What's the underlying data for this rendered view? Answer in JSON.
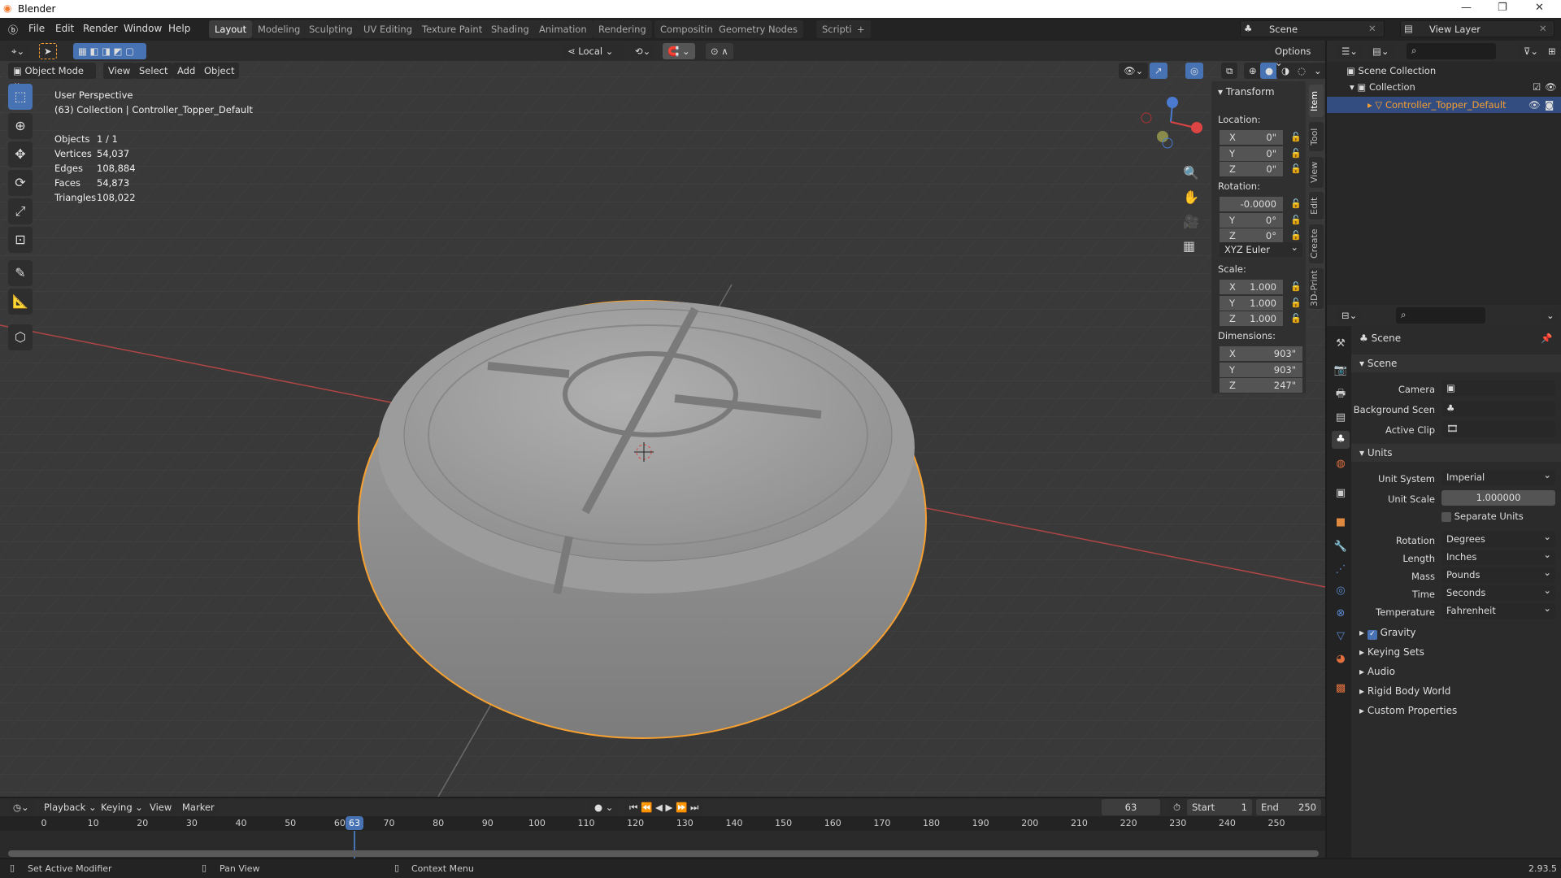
{
  "window": {
    "title": "Blender",
    "controls": [
      "—",
      "❐",
      "✕"
    ]
  },
  "menu": [
    "File",
    "Edit",
    "Render",
    "Window",
    "Help"
  ],
  "workspaces": [
    "Layout",
    "Modeling",
    "Sculpting",
    "UV Editing",
    "Texture Paint",
    "Shading",
    "Animation",
    "Rendering",
    "Compositing",
    "Geometry Nodes",
    "Scripting",
    "+"
  ],
  "active_workspace": "Layout",
  "scene": {
    "name": "Scene",
    "view_layer": "View Layer"
  },
  "viewport_header": {
    "transform_orientation": "Local",
    "options": "Options",
    "mode": "Object Mode",
    "menus": [
      "View",
      "Select",
      "Add",
      "Object"
    ]
  },
  "overlay": {
    "view": "User Perspective",
    "context": "(63) Collection | Controller_Topper_Default",
    "stats": [
      {
        "label": "Objects",
        "value": "1 / 1"
      },
      {
        "label": "Vertices",
        "value": "54,037"
      },
      {
        "label": "Edges",
        "value": "108,884"
      },
      {
        "label": "Faces",
        "value": "54,873"
      },
      {
        "label": "Triangles",
        "value": "108,022"
      }
    ]
  },
  "tools": [
    "select-box",
    "cursor",
    "move",
    "rotate",
    "scale",
    "transform",
    "annotate",
    "measure",
    "add-cube"
  ],
  "npanel": {
    "title": "Transform",
    "location_label": "Location:",
    "location": [
      {
        "axis": "X",
        "value": "0\""
      },
      {
        "axis": "Y",
        "value": "0\""
      },
      {
        "axis": "Z",
        "value": "0\""
      }
    ],
    "rotation_label": "Rotation:",
    "rotation": [
      {
        "axis": "",
        "value": "-0.0000"
      },
      {
        "axis": "Y",
        "value": "0°"
      },
      {
        "axis": "Z",
        "value": "0°"
      }
    ],
    "rotation_mode": "XYZ Euler",
    "scale_label": "Scale:",
    "scale": [
      {
        "axis": "X",
        "value": "1.000"
      },
      {
        "axis": "Y",
        "value": "1.000"
      },
      {
        "axis": "Z",
        "value": "1.000"
      }
    ],
    "dimensions_label": "Dimensions:",
    "dimensions": [
      {
        "axis": "X",
        "value": "903\""
      },
      {
        "axis": "Y",
        "value": "903\""
      },
      {
        "axis": "Z",
        "value": "247\""
      }
    ],
    "tabs": [
      "Item",
      "Tool",
      "View",
      "Edit",
      "Create",
      "3D-Print"
    ]
  },
  "outliner": {
    "root": "Scene Collection",
    "collection": "Collection",
    "object": "Controller_Topper_Default"
  },
  "properties": {
    "context": "Scene",
    "scene_section": "Scene",
    "camera_label": "Camera",
    "bg_label": "Background Scen",
    "clip_label": "Active Clip",
    "units_section": "Units",
    "unit_system_label": "Unit System",
    "unit_system": "Imperial",
    "unit_scale_label": "Unit Scale",
    "unit_scale": "1.000000",
    "separate_units": "Separate Units",
    "separate_units_checked": false,
    "rows": [
      {
        "label": "Rotation",
        "value": "Degrees"
      },
      {
        "label": "Length",
        "value": "Inches"
      },
      {
        "label": "Mass",
        "value": "Pounds"
      },
      {
        "label": "Time",
        "value": "Seconds"
      },
      {
        "label": "Temperature",
        "value": "Fahrenheit"
      }
    ],
    "gravity": "Gravity",
    "gravity_checked": true,
    "collapsed": [
      "Keying Sets",
      "Audio",
      "Rigid Body World",
      "Custom Properties"
    ]
  },
  "timeline": {
    "menus": [
      "Playback",
      "Keying",
      "View",
      "Marker"
    ],
    "current_frame": "63",
    "start_label": "Start",
    "start": "1",
    "end_label": "End",
    "end": "250",
    "ticks": [
      "0",
      "10",
      "20",
      "30",
      "40",
      "50",
      "60",
      "70",
      "80",
      "90",
      "100",
      "110",
      "120",
      "130",
      "140",
      "150",
      "160",
      "170",
      "180",
      "190",
      "200",
      "210",
      "220",
      "230",
      "240",
      "250"
    ]
  },
  "statusbar": {
    "left": "Set Active Modifier",
    "middle": "Pan View",
    "right": "Context Menu",
    "version": "2.93.5"
  },
  "colors": {
    "accent": "#4772b3",
    "selection": "#f5a031",
    "x_axis": "#c94a4a",
    "header": "#2c2c2c"
  }
}
